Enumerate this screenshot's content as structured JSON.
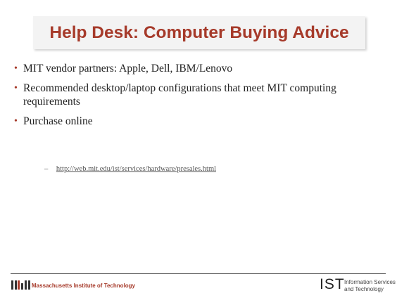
{
  "slide": {
    "title": "Help Desk: Computer Buying Advice",
    "bullets": [
      "MIT vendor partners: Apple, Dell, IBM/Lenovo",
      "Recommended desktop/laptop configurations that meet MIT computing requirements",
      "Purchase online"
    ],
    "sub_bullet": {
      "dash": "–",
      "link": "http://web.mit.edu/ist/services/hardware/presales.html"
    }
  },
  "footer": {
    "left_name": "Massachusetts Institute of Technology",
    "right_logo": "IST",
    "right_line1": "Information Services",
    "right_line2": "and Technology"
  },
  "colors": {
    "accent": "#a63a2a",
    "title_box": "#f3f3f3",
    "text": "#222222"
  }
}
